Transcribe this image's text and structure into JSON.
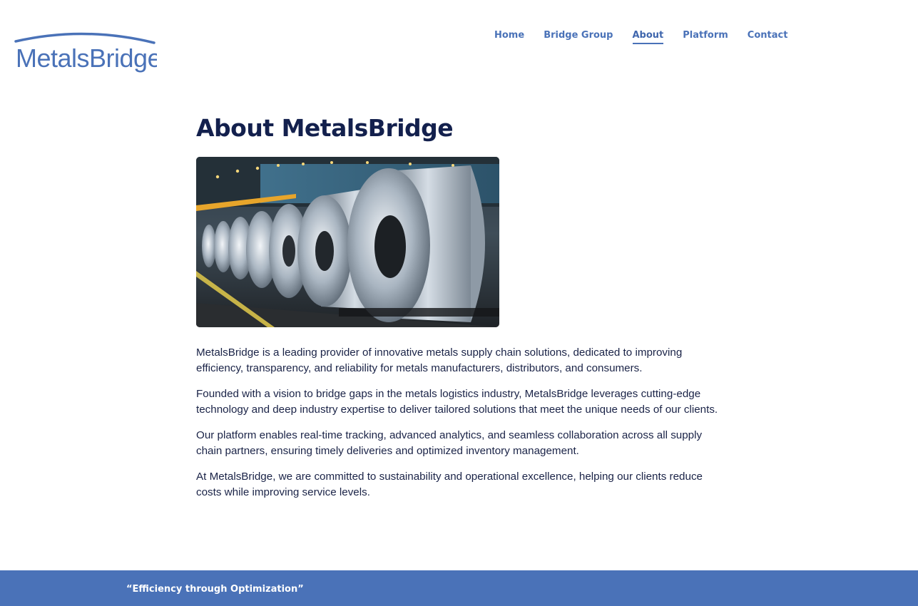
{
  "logo": {
    "text": "MetalsBridge"
  },
  "nav": {
    "items": [
      {
        "label": "Home"
      },
      {
        "label": "Bridge Group"
      },
      {
        "label": "About"
      },
      {
        "label": "Platform"
      },
      {
        "label": "Contact"
      }
    ],
    "active": "About"
  },
  "main": {
    "title": "About MetalsBridge",
    "paragraphs": [
      "MetalsBridge is a leading provider of innovative metals supply chain solutions, dedicated to improving efficiency, transparency, and reliability for metals manufacturers, distributors, and consumers.",
      "Founded with a vision to bridge gaps in the metals logistics industry, MetalsBridge leverages cutting-edge technology and deep industry expertise to deliver tailored solutions that meet the unique needs of our clients.",
      "Our platform enables real-time tracking, advanced analytics, and seamless collaboration across all supply chain partners, ensuring timely deliveries and optimized inventory management.",
      "At MetalsBridge, we are committed to sustainability and operational excellence, helping our clients reduce costs while improving service levels."
    ]
  },
  "footer": {
    "tagline": "“Efficiency through Optimization”"
  },
  "colors": {
    "accent": "#4a72b8",
    "title": "#13204d",
    "body_text": "#1a2347",
    "logo_gray": "#8b8d91"
  }
}
